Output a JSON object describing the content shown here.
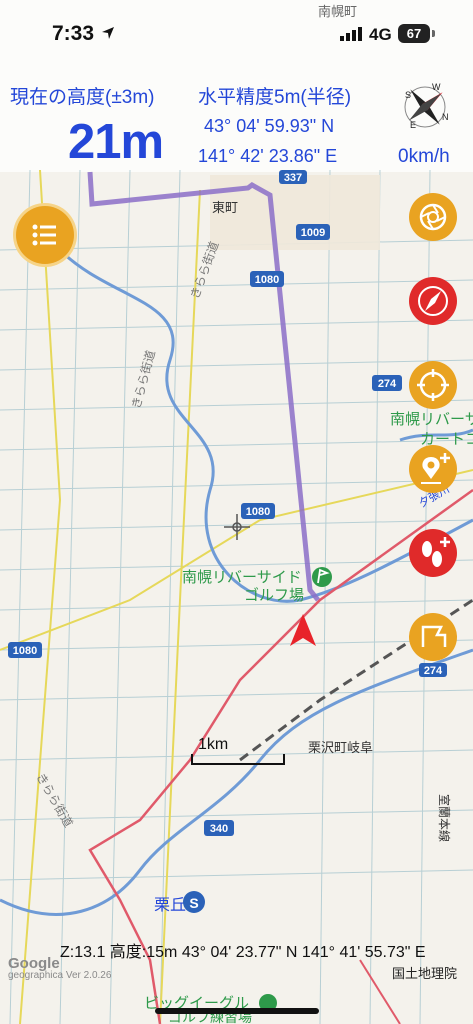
{
  "status_bar": {
    "time": "7:33",
    "network": "4G",
    "battery": "67"
  },
  "header": {
    "altitude_label": "現在の高度(±3m)",
    "altitude_value": "21m",
    "accuracy_label": "水平精度5m(半径)",
    "latitude": "43° 04' 59.93\" N",
    "longitude": "141° 42' 23.86\" E",
    "speed": "0km/h"
  },
  "map_labels": {
    "town_higashi": "東町",
    "town_top": "南幌町",
    "kirara1": "きらら街道",
    "kirara2": "きらら街道",
    "kirara3": "きらら街道",
    "golf": "南幌リバーサイド",
    "golf2": "ゴルフ場",
    "rivercart": "南幌リバーサ",
    "rivercart2": "カートコ",
    "kurisawa": "栗沢町岐阜",
    "kurioka": "栗丘",
    "bigeagle": "ビッグイーグル",
    "bigeagle2": "ゴルフ練習場",
    "road_vert": "夕張川",
    "rail": "室蘭本線"
  },
  "route_shields": [
    "337",
    "1009",
    "1080",
    "274",
    "1080",
    "1080",
    "274",
    "340"
  ],
  "scale": {
    "label": "1km"
  },
  "footer": {
    "coords": "Z:13.1 高度:15m  43° 04' 23.77\" N 141° 41' 55.73\" E",
    "attribution": "国土地理院",
    "brand": "Google",
    "version": "geographica Ver 2.0.26"
  },
  "colors": {
    "header_blue": "#2447d8",
    "track_purple": "#8b6fc8",
    "boundary_red": "#e05a6a",
    "button_orange": "#e9a321",
    "button_red": "#e02a2a",
    "position_red": "#e8232a"
  }
}
